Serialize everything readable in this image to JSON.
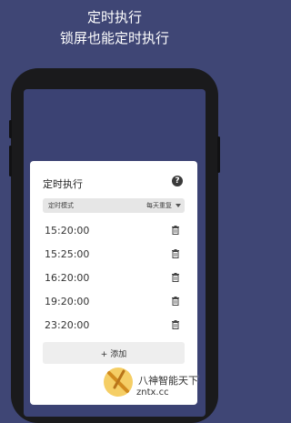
{
  "header": {
    "line1": "定时执行",
    "line2": "锁屏也能定时执行"
  },
  "card": {
    "title": "定时执行",
    "help_icon": "?",
    "mode_label": "定时模式",
    "mode_value": "每天重复",
    "times": [
      "15:20:00",
      "15:25:00",
      "16:20:00",
      "19:20:00",
      "23:20:00"
    ],
    "add_label": "添加",
    "add_icon": "+"
  },
  "watermark": {
    "text": "八神智能天下",
    "url": "zntx.cc"
  },
  "colors": {
    "background": "#3f4675",
    "screen": "#3b4273",
    "card": "#ffffff"
  }
}
